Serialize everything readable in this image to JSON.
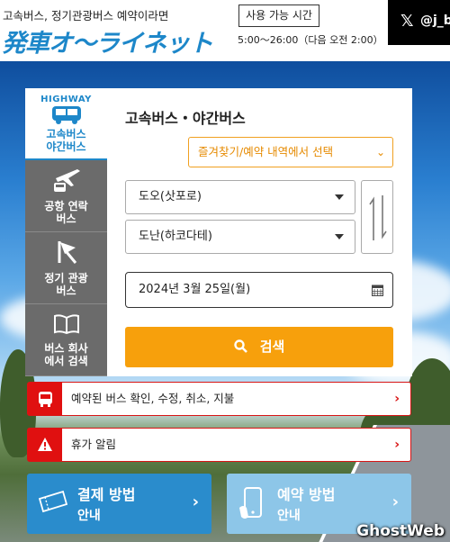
{
  "header": {
    "tagline": "고속버스, 정기관광버스 예약이라면",
    "logo": "発車オ〜ライネット",
    "hours_label": "사용 가능 시간",
    "hours": "5:00〜26:00（다음 오전 2:00）",
    "x_handle": "@j_b"
  },
  "tabs": [
    {
      "badge": "HIGHWAY",
      "label": "고속버스\n야간버스",
      "icon": "highway-bus-icon",
      "active": true
    },
    {
      "label": "공항 연락\n버스",
      "icon": "airplane-bus-icon",
      "active": false
    },
    {
      "label": "정기 관광\n버스",
      "icon": "flag-icon",
      "active": false
    },
    {
      "label": "버스 회사\n에서 검색",
      "icon": "book-icon",
      "active": false
    }
  ],
  "panel": {
    "title": "고속버스・야간버스",
    "favorites_label": "즐겨찾기/예약 내역에서 선택",
    "origin": "도오(삿포로)",
    "destination": "도난(하코다테)",
    "date": "2024년 3월 25일(월)",
    "search_label": "검색"
  },
  "links": {
    "reservation": "예약된 버스 확인, 수정, 취소, 지불",
    "holiday": "휴가 알림"
  },
  "cards": {
    "payment": {
      "title": "결제 방법",
      "sub": "안내"
    },
    "booking": {
      "title": "예약 방법",
      "sub": "안내"
    }
  },
  "watermark": "GhostWeb",
  "colors": {
    "brand_blue": "#1d87c9",
    "accent_orange": "#f7a00c",
    "alert_red": "#e01010",
    "card_dark": "#2a8ccc",
    "card_light": "#8dc6e8"
  }
}
